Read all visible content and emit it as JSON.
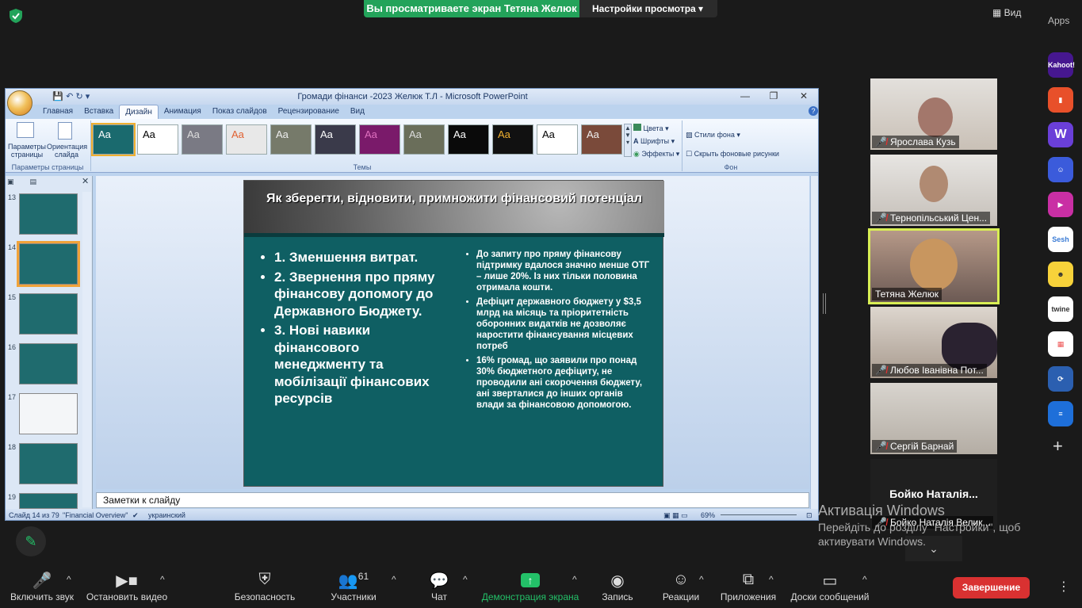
{
  "zoom_top": {
    "share_banner": "Вы просматриваете экран Тетяна Желюк",
    "view_options": "Настройки просмотра",
    "view_button": "Вид",
    "apps_label": "Apps"
  },
  "ppt": {
    "title": "Громади фінанси -2023 Желюк Т.Л - Microsoft PowerPoint",
    "tabs": [
      "Главная",
      "Вставка",
      "Дизайн",
      "Анимация",
      "Показ слайдов",
      "Рецензирование",
      "Вид"
    ],
    "ribbon": {
      "page_setup_1": "Параметры страницы",
      "page_setup_2": "Ориентация слайда",
      "group_page_setup": "Параметры страницы",
      "group_themes": "Темы",
      "colors": "Цвета",
      "fonts": "Шрифты",
      "effects": "Эффекты",
      "bg_styles": "Стили фона",
      "hide_bg": "Скрыть фоновые рисунки",
      "group_bg": "Фон",
      "theme_sample": "Aa"
    },
    "thumb_numbers": [
      "13",
      "14",
      "15",
      "16",
      "17",
      "18",
      "19"
    ],
    "slide": {
      "title": "Як  зберегти, відновити, примножити фінансовий потенціал",
      "left_items": [
        "1. Зменшення витрат.",
        "2. Звернення про пряму фінансову допомогу до Державного Бюджету.",
        "3. Нові навики фінансового менеджменту та мобілізації фінансових ресурсів"
      ],
      "right_items": [
        "До запиту про пряму фінансову підтримку вдалося значно менше ОТГ – лише 20%. Із них тільки половина отримала кошти.",
        "Дефіцит державного бюджету у $3,5 млрд на місяць та пріоритетність оборонних видатків не дозволяє наростити фінансування місцевих потреб",
        "16% громад, що заявили про понад 30% бюджетного дефіциту, не проводили ані скорочення бюджету, ані зверталися до інших органів влади за фінансовою допомогою."
      ]
    },
    "notes_placeholder": "Заметки к слайду",
    "status": {
      "slide": "Слайд 14 из 79",
      "theme": "\"Financial Overview\"",
      "lang": "украинский",
      "zoom": "69%"
    }
  },
  "participants": [
    {
      "name": "Ярослава Кузь"
    },
    {
      "name": "Тернопільський Цен..."
    },
    {
      "name": "Тетяна Желюк"
    },
    {
      "name": "Любов Іванівна Пот..."
    },
    {
      "name": "Сергій Барнай"
    },
    {
      "name": "Бойко Наталія Велик...",
      "big_name": "Бойко  Наталія..."
    }
  ],
  "apps": [
    "Kahoot!",
    "Sesh",
    "twine"
  ],
  "watermark": {
    "line1": "Активація Windows",
    "line2": "Перейдіть до розділу \"Настройки\", щоб",
    "line3": "активувати Windows."
  },
  "toolbar": {
    "unmute": "Включить звук",
    "video": "Остановить видео",
    "security": "Безопасность",
    "participants": "Участники",
    "participants_count": "61",
    "chat": "Чат",
    "share": "Демонстрация экрана",
    "record": "Запись",
    "reactions": "Реакции",
    "apps": "Приложения",
    "whiteboard": "Доски сообщений",
    "end": "Завершение"
  }
}
